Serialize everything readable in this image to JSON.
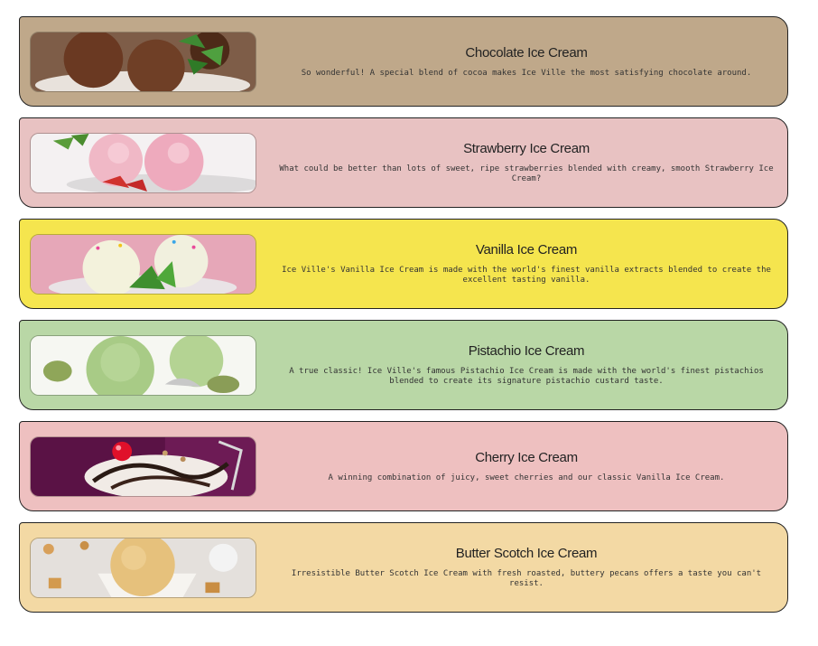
{
  "items": [
    {
      "title": "Chocolate Ice Cream",
      "description": "So wonderful! A special blend of cocoa makes Ice Ville the most satisfying chocolate around.",
      "bg": "#bfa88a",
      "image_icon": "chocolate-ice-cream-photo"
    },
    {
      "title": "Strawberry Ice Cream",
      "description": "What could be better than lots of sweet, ripe strawberries blended with creamy, smooth Strawberry Ice Cream?",
      "bg": "#e8c2c2",
      "image_icon": "strawberry-ice-cream-photo"
    },
    {
      "title": "Vanilla Ice Cream",
      "description": "Ice Ville's Vanilla Ice Cream is made with the world's finest vanilla extracts blended to create the excellent tasting vanilla.",
      "bg": "#f5e54e",
      "image_icon": "vanilla-ice-cream-photo"
    },
    {
      "title": "Pistachio Ice Cream",
      "description": "A true classic! Ice Ville's famous Pistachio Ice Cream is made with the world's finest pistachios blended to create its signature pistachio custard taste.",
      "bg": "#b9d7a6",
      "image_icon": "pistachio-ice-cream-photo"
    },
    {
      "title": "Cherry Ice Cream",
      "description": "A winning combination of juicy, sweet cherries and our classic Vanilla Ice Cream.",
      "bg": "#eec0c0",
      "image_icon": "cherry-sundae-photo"
    },
    {
      "title": "Butter Scotch Ice Cream",
      "description": "Irresistible Butter Scotch Ice Cream with fresh roasted, buttery pecans offers a taste you can't resist.",
      "bg": "#f3d9a4",
      "image_icon": "butter-scotch-ice-cream-photo"
    }
  ]
}
